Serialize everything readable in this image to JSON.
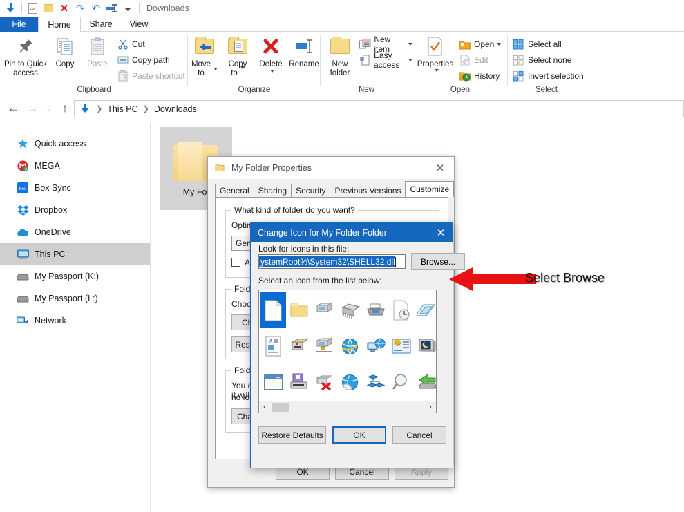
{
  "window": {
    "title": "Downloads",
    "quick_access_toolbar": [
      {
        "name": "downloads-arrow-icon",
        "label": "Downloads"
      },
      {
        "name": "properties-icon",
        "label": "Properties"
      },
      {
        "name": "new-folder-icon",
        "label": "New folder"
      },
      {
        "name": "delete-icon",
        "label": "Delete"
      },
      {
        "name": "redo-icon",
        "label": "Redo"
      },
      {
        "name": "undo-icon",
        "label": "Undo"
      },
      {
        "name": "minimize-ribbon-icon",
        "label": "Minimize the Ribbon"
      },
      {
        "name": "customize-qat-icon",
        "label": "Customize Quick Access Toolbar"
      }
    ]
  },
  "tabs": [
    {
      "label": "File",
      "type": "file"
    },
    {
      "label": "Home",
      "type": "active"
    },
    {
      "label": "Share",
      "type": "normal"
    },
    {
      "label": "View",
      "type": "normal"
    }
  ],
  "ribbon": {
    "groups": [
      {
        "label": "Clipboard",
        "big": [
          {
            "label": "Pin to Quick\naccess",
            "icon": "pin-icon"
          },
          {
            "label": "Copy",
            "icon": "copy-icon"
          },
          {
            "label": "Paste",
            "icon": "paste-icon",
            "disabled": true
          }
        ],
        "small": [
          {
            "label": "Cut",
            "icon": "scissors-icon",
            "disabled": false
          },
          {
            "label": "Copy path",
            "icon": "copy-path-icon",
            "disabled": false
          },
          {
            "label": "Paste shortcut",
            "icon": "paste-shortcut-icon",
            "disabled": true
          }
        ]
      },
      {
        "label": "Organize",
        "big": [
          {
            "label": "Move\nto",
            "icon": "move-to-icon",
            "dropdown": true
          },
          {
            "label": "Copy\nto",
            "icon": "copy-to-icon",
            "dropdown": true
          },
          {
            "label": "Delete",
            "icon": "delete-x-icon",
            "dropdown": true
          },
          {
            "label": "Rename",
            "icon": "rename-icon"
          }
        ],
        "small": []
      },
      {
        "label": "New",
        "big": [
          {
            "label": "New\nfolder",
            "icon": "new-folder-icon"
          }
        ],
        "small": [
          {
            "label": "New item",
            "icon": "new-item-icon",
            "dropdown": true
          },
          {
            "label": "Easy access",
            "icon": "easy-access-icon",
            "dropdown": true
          }
        ]
      },
      {
        "label": "Open",
        "big": [
          {
            "label": "Properties",
            "icon": "properties-icon",
            "dropdown": true
          }
        ],
        "small": [
          {
            "label": "Open",
            "icon": "open-folder-icon",
            "dropdown": true
          },
          {
            "label": "Edit",
            "icon": "edit-icon",
            "disabled": true
          },
          {
            "label": "History",
            "icon": "history-icon"
          }
        ]
      },
      {
        "label": "Select",
        "big": [],
        "small": [
          {
            "label": "Select all",
            "icon": "select-all-icon"
          },
          {
            "label": "Select none",
            "icon": "select-none-icon"
          },
          {
            "label": "Invert selection",
            "icon": "invert-selection-icon"
          }
        ]
      }
    ]
  },
  "nav": {
    "back": "←",
    "forward": "→",
    "recent": "⌄",
    "up": "↑",
    "breadcrumbs": [
      "This PC",
      "Downloads"
    ],
    "breadcrumb_icon": "downloads-arrow-icon"
  },
  "sidebar": {
    "items": [
      {
        "label": "Quick access",
        "icon": "star-pin-icon",
        "selected": false
      },
      {
        "label": "MEGA",
        "icon": "mega-icon",
        "selected": false
      },
      {
        "label": "Box Sync",
        "icon": "box-sync-icon",
        "selected": false
      },
      {
        "label": "Dropbox",
        "icon": "dropbox-icon",
        "selected": false
      },
      {
        "label": "OneDrive",
        "icon": "onedrive-cloud-icon",
        "selected": false
      },
      {
        "label": "This PC",
        "icon": "this-pc-icon",
        "selected": true
      },
      {
        "label": "My Passport (K:)",
        "icon": "drive-icon",
        "selected": false
      },
      {
        "label": "My Passport (L:)",
        "icon": "drive-icon",
        "selected": false
      },
      {
        "label": "Network",
        "icon": "network-icon",
        "selected": false
      }
    ]
  },
  "content": {
    "items": [
      {
        "name": "My Folder",
        "display": "My Fol",
        "icon": "folder-icon",
        "selected": true
      }
    ]
  },
  "properties_dialog": {
    "title": "My Folder Properties",
    "title_icon": "folder-icon",
    "close_label": "✕",
    "tabs": [
      {
        "label": "General",
        "selected": false
      },
      {
        "label": "Sharing",
        "selected": false
      },
      {
        "label": "Security",
        "selected": false
      },
      {
        "label": "Previous Versions",
        "selected": false
      },
      {
        "label": "Customize",
        "selected": true
      }
    ],
    "folder_type_group": {
      "legend": "What kind of folder do you want?",
      "optimize_label": "Optimize this folder for:",
      "combo_value": "General items",
      "checkbox_label": "Also apply this template to all subfolders"
    },
    "folder_pictures_group": {
      "legend": "Folder pictures",
      "description": "Choose a file to show on this folder icon",
      "choose_button": "Choose File",
      "restore_button": "Restore Default"
    },
    "folder_icons_group": {
      "legend": "Folder icons",
      "description_line1": "You can change the folder icon. If you change the icon, it will",
      "description_line2": "no longer show a preview of the folder's contents.",
      "change_button": "Change Icon..."
    },
    "footer": {
      "ok": "OK",
      "cancel": "Cancel",
      "apply": "Apply",
      "apply_disabled": true
    }
  },
  "change_icon_dialog": {
    "title": "Change Icon for My Folder Folder",
    "close_label": "✕",
    "file_label": "Look for icons in this file:",
    "file_value": "ystemRoot%\\System32\\SHELL32.dll",
    "browse_button": "Browse...",
    "list_label": "Select an icon from the list below:",
    "icons": [
      {
        "name": "blank-page-icon",
        "selected": true
      },
      {
        "name": "folder-icon",
        "selected": false
      },
      {
        "name": "computer-icon",
        "selected": false
      },
      {
        "name": "memory-chip-icon",
        "selected": false
      },
      {
        "name": "printer-icon",
        "selected": false
      },
      {
        "name": "recent-document-icon",
        "selected": false
      },
      {
        "name": "window-stack-icon",
        "selected": false
      },
      {
        "name": "edge-partial-icon",
        "selected": false
      },
      {
        "name": "document-text-icon",
        "selected": false
      },
      {
        "name": "network-computer-icon",
        "selected": false
      },
      {
        "name": "network-drive-icon",
        "selected": false
      },
      {
        "name": "globe-internet-icon",
        "selected": false
      },
      {
        "name": "network-globe-icon",
        "selected": false
      },
      {
        "name": "presentation-icon",
        "selected": false
      },
      {
        "name": "monitor-night-icon",
        "selected": false
      },
      {
        "name": "shortcut-arrow-icon",
        "selected": false
      },
      {
        "name": "window-icon",
        "selected": false
      },
      {
        "name": "floppy-disk-icon",
        "selected": false
      },
      {
        "name": "disconnected-drive-icon",
        "selected": false
      },
      {
        "name": "globe-sphere-icon",
        "selected": false
      },
      {
        "name": "network-nodes-icon",
        "selected": false
      },
      {
        "name": "magnifier-search-icon",
        "selected": false
      },
      {
        "name": "back-arrow-drive-icon",
        "selected": false
      },
      {
        "name": "clock-small-icon",
        "selected": false
      },
      {
        "name": "folder-plain-icon",
        "selected": false
      },
      {
        "name": "hard-drive-icon",
        "selected": false
      },
      {
        "name": "cd-drive-icon",
        "selected": false
      },
      {
        "name": "monitor-keyboard-icon",
        "selected": false
      },
      {
        "name": "folder-grid-icon",
        "selected": false
      },
      {
        "name": "help-question-icon",
        "selected": false
      },
      {
        "name": "shutdown-power-icon",
        "selected": false
      },
      {
        "name": "recycle-bin-icon",
        "selected": false
      }
    ],
    "scroll_left": "‹",
    "scroll_right": "›",
    "buttons": {
      "restore_defaults": "Restore Defaults",
      "ok": "OK",
      "cancel": "Cancel"
    }
  },
  "annotation": {
    "text": "Select Browse",
    "arrow_color": "#e81212",
    "arrow_name": "red-pointer-arrow"
  },
  "colors": {
    "accent_blue": "#1567bf",
    "selection_blue": "#0a6cd0",
    "sidebar_selected": "#cfcfcf",
    "annotation_red": "#e81212"
  }
}
